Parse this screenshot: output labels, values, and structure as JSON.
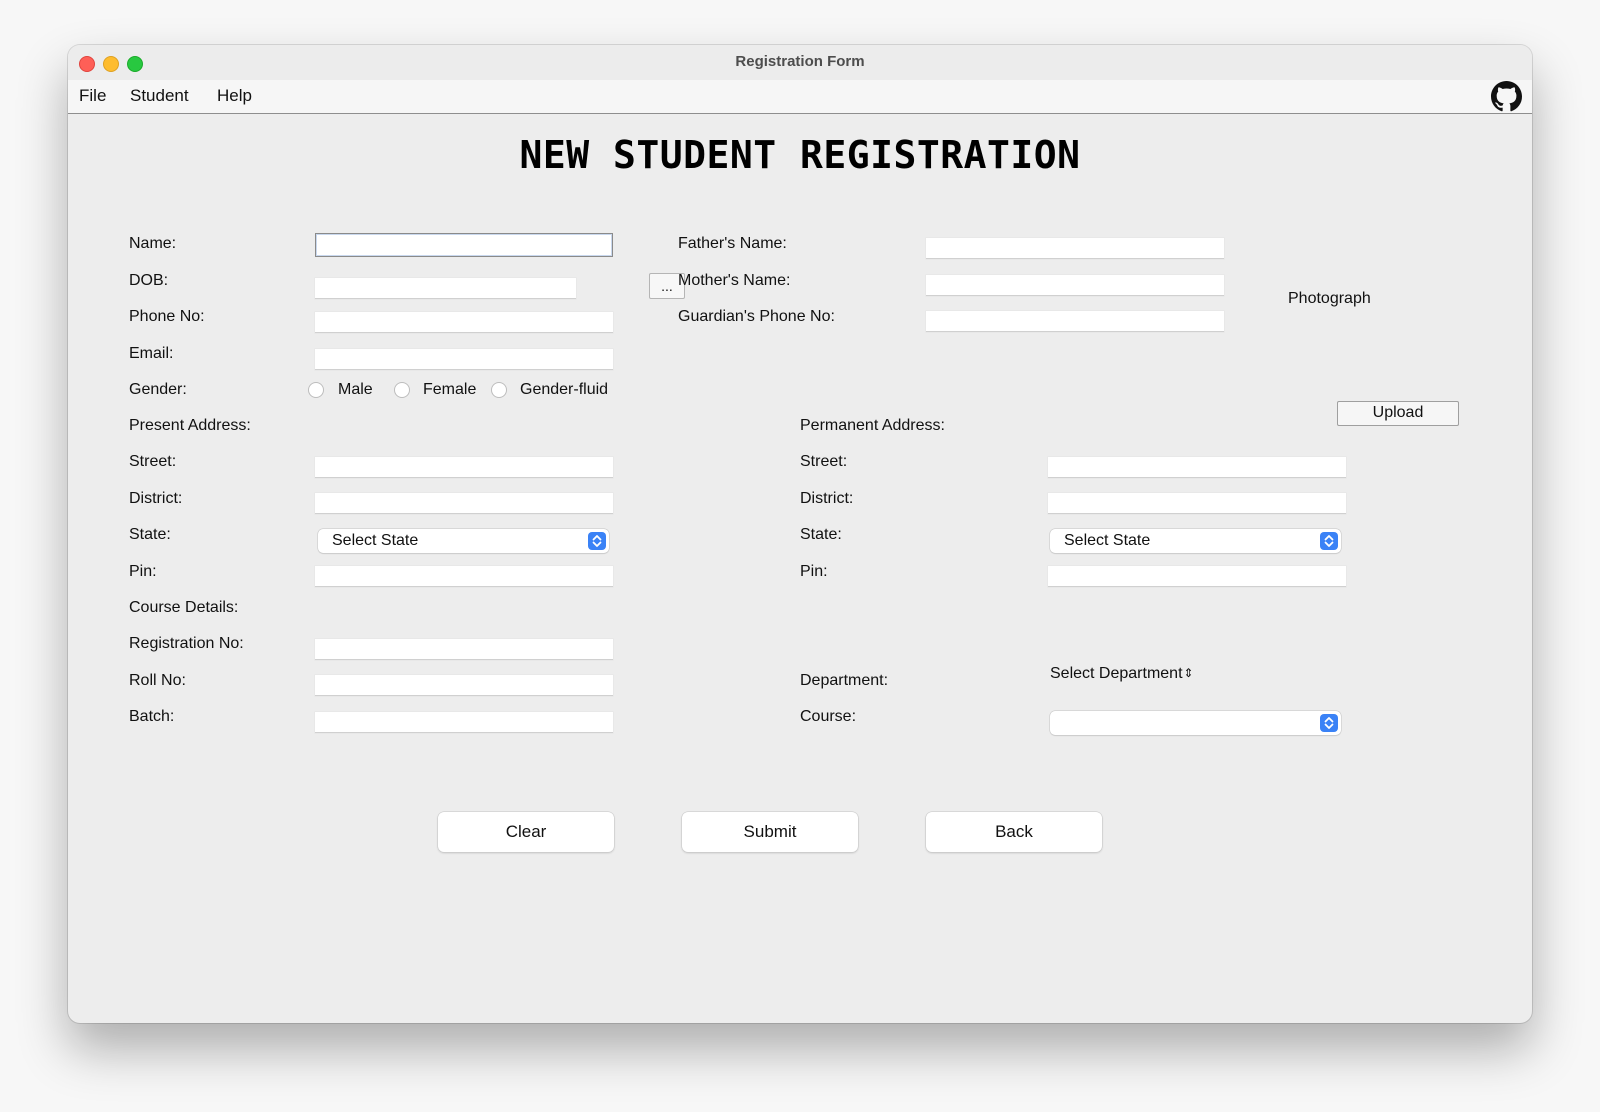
{
  "window": {
    "title": "Registration Form"
  },
  "menu": {
    "file": "File",
    "student": "Student",
    "help": "Help"
  },
  "heading": "NEW STUDENT REGISTRATION",
  "personal": {
    "name_label": "Name:",
    "dob_label": "DOB:",
    "dob_button": "...",
    "phone_label": "Phone No:",
    "email_label": "Email:",
    "gender_label": "Gender:",
    "gender_options": [
      "Male",
      "Female",
      "Gender-fluid"
    ]
  },
  "parents": {
    "father_label": "Father's Name:",
    "mother_label": "Mother's Name:",
    "guardian_phone_label": "Guardian's Phone No:"
  },
  "photo": {
    "label": "Photograph",
    "upload_button": "Upload"
  },
  "present_address": {
    "title": "Present Address:",
    "street_label": "Street:",
    "district_label": "District:",
    "state_label": "State:",
    "state_value": "Select State",
    "pin_label": "Pin:"
  },
  "permanent_address": {
    "title": "Permanent Address:",
    "street_label": "Street:",
    "district_label": "District:",
    "state_label": "State:",
    "state_value": "Select State",
    "pin_label": "Pin:"
  },
  "course": {
    "title": "Course Details:",
    "registration_label": "Registration No:",
    "roll_label": "Roll No:",
    "batch_label": "Batch:",
    "department_label": "Department:",
    "department_value": "Select Department",
    "course_label": "Course:",
    "course_value": ""
  },
  "buttons": {
    "clear": "Clear",
    "submit": "Submit",
    "back": "Back"
  },
  "icons": {
    "github": "github-icon",
    "stepper": "select-stepper-icon"
  },
  "colors": {
    "accent": "#3a82f6",
    "close": "#fe5f57",
    "minimize": "#febc2e",
    "zoom": "#28c840"
  }
}
